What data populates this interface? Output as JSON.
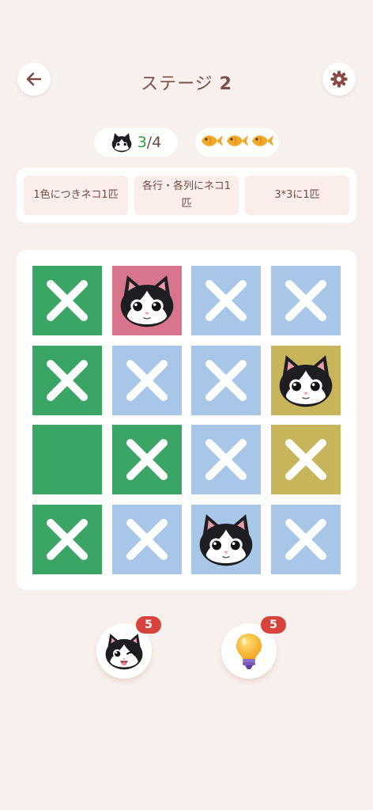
{
  "header": {
    "title": "ステージ",
    "stage_number": "2"
  },
  "stats": {
    "cats_found": "3",
    "cats_total": "/4",
    "fish_icons": [
      "fish-icon",
      "fish-icon",
      "fish-icon"
    ]
  },
  "rules": [
    "1色につきネコ1匹",
    "各行・各列にネコ1匹",
    "3*3に1匹"
  ],
  "colors": {
    "green": "#3aa564",
    "pink": "#d6758c",
    "blue": "#a8c7e8",
    "mustard": "#c7b45b",
    "mark": "#ffffff"
  },
  "board": {
    "rows": [
      [
        {
          "color": "green",
          "mark": "x"
        },
        {
          "color": "pink",
          "mark": "cat"
        },
        {
          "color": "blue",
          "mark": "x"
        },
        {
          "color": "blue",
          "mark": "x"
        }
      ],
      [
        {
          "color": "green",
          "mark": "x"
        },
        {
          "color": "blue",
          "mark": "x"
        },
        {
          "color": "blue",
          "mark": "x"
        },
        {
          "color": "mustard",
          "mark": "cat"
        }
      ],
      [
        {
          "color": "green",
          "mark": "empty"
        },
        {
          "color": "green",
          "mark": "x"
        },
        {
          "color": "blue",
          "mark": "x"
        },
        {
          "color": "mustard",
          "mark": "x"
        }
      ],
      [
        {
          "color": "green",
          "mark": "x"
        },
        {
          "color": "blue",
          "mark": "x"
        },
        {
          "color": "blue",
          "mark": "cat"
        },
        {
          "color": "blue",
          "mark": "x"
        }
      ]
    ]
  },
  "tools": {
    "cat_hint_count": "5",
    "bulb_hint_count": "5"
  }
}
